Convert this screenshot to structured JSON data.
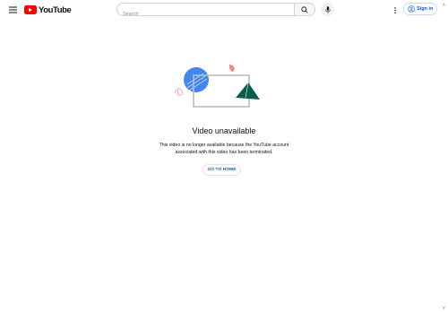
{
  "header": {
    "logo_text": "YouTube",
    "search": {
      "placeholder": "Search"
    },
    "sign_in_label": "Sign in"
  },
  "error": {
    "title": "Video unavailable",
    "message_line1": "This video is no longer available because the YouTube account",
    "message_line2": "associated with this video has been terminated.",
    "home_button_label": "GO TO HOME"
  },
  "colors": {
    "brand_red": "#ff0000",
    "link_blue": "#065fd4",
    "illustration_blue": "#4285f4",
    "illustration_teal": "#0b5d4e",
    "illustration_pink": "#f28b82"
  }
}
